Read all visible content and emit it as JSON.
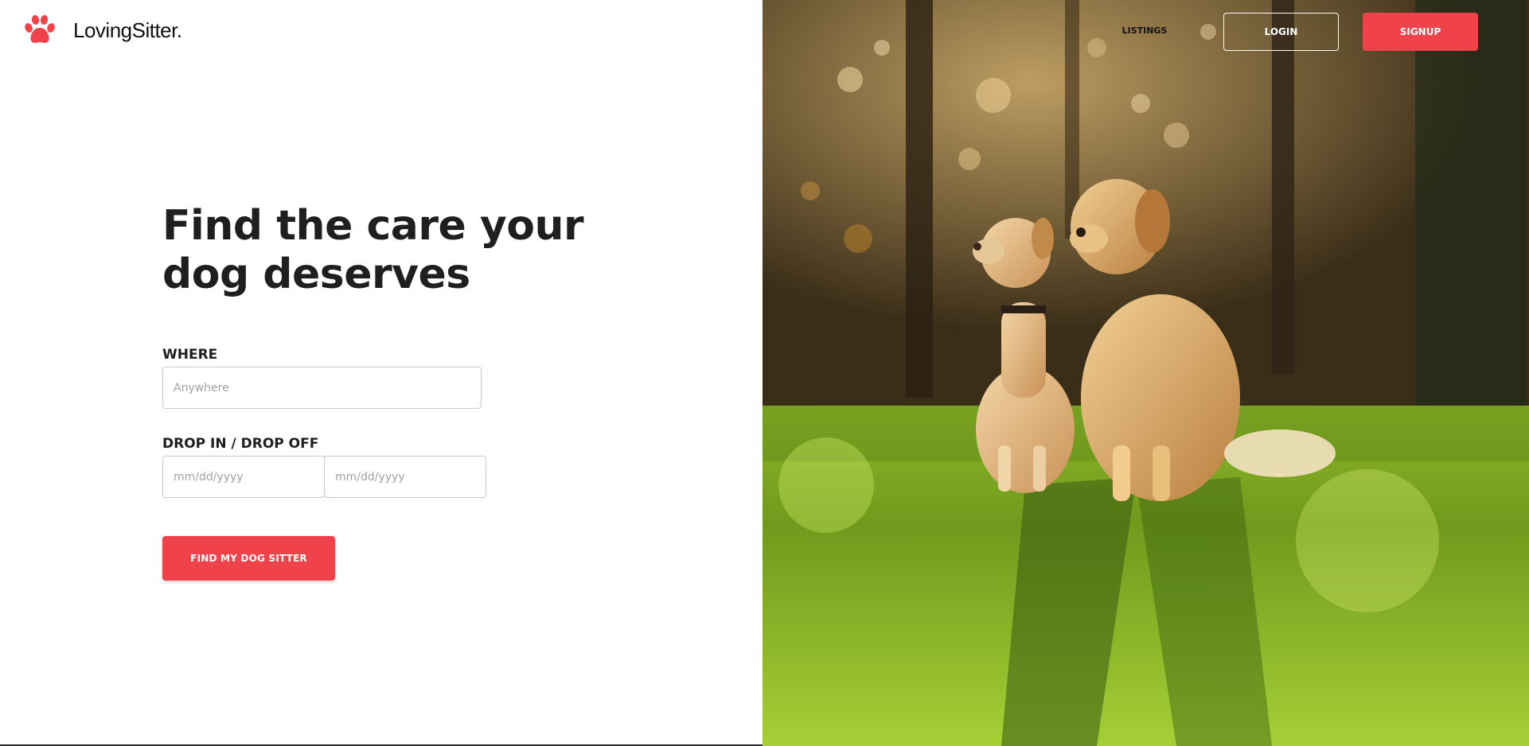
{
  "brand": {
    "name": "LovingSitter.",
    "logo_icon": "paw-icon",
    "accent_color": "#f0424a"
  },
  "nav": {
    "listings_label": "LISTINGS",
    "login_label": "LOGIN",
    "signup_label": "SIGNUP"
  },
  "hero": {
    "title": "Find the care your dog deserves"
  },
  "search": {
    "where_label": "WHERE",
    "where_placeholder": "Anywhere",
    "dates_label": "DROP IN / DROP OFF",
    "drop_in_placeholder": "mm/dd/yyyy",
    "drop_off_placeholder": "mm/dd/yyyy",
    "submit_label": "FIND MY DOG SITTER"
  },
  "hero_image": {
    "subject": "two-dogs-on-grass-photo"
  }
}
